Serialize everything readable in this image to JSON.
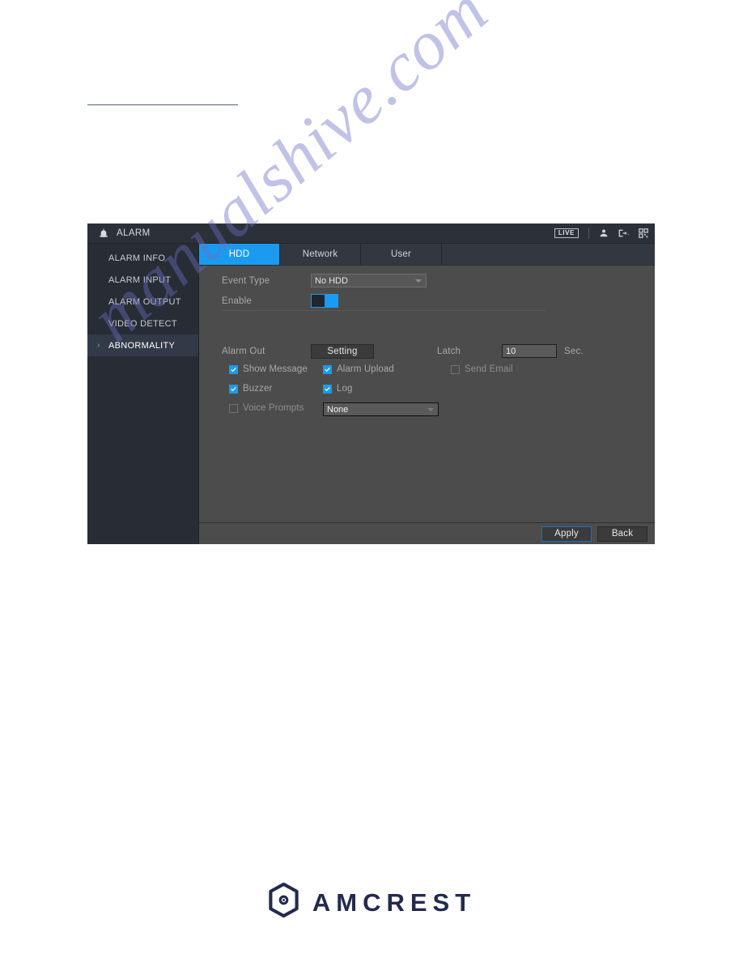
{
  "window": {
    "title": "ALARM",
    "title_icon": "alarm-siren-icon",
    "live_badge": "LIVE",
    "icons": [
      "user-icon",
      "logout-icon",
      "qr-code-icon"
    ]
  },
  "sidebar": {
    "items": [
      {
        "label": "ALARM INFO",
        "active": false
      },
      {
        "label": "ALARM INPUT",
        "active": false
      },
      {
        "label": "ALARM OUTPUT",
        "active": false
      },
      {
        "label": "VIDEO DETECT",
        "active": false
      },
      {
        "label": "ABNORMALITY",
        "active": true
      }
    ]
  },
  "tabs": [
    {
      "label": "HDD",
      "active": true
    },
    {
      "label": "Network",
      "active": false
    },
    {
      "label": "User",
      "active": false
    }
  ],
  "form": {
    "event_type_label": "Event Type",
    "event_type_value": "No HDD",
    "enable_label": "Enable",
    "enable_state": "on",
    "alarm_out_label": "Alarm Out",
    "setting_button": "Setting",
    "latch_label": "Latch",
    "latch_value": "10",
    "latch_unit": "Sec.",
    "checkboxes": [
      {
        "label": "Show Message",
        "checked": true
      },
      {
        "label": "Alarm Upload",
        "checked": true
      },
      {
        "label": "Send Email",
        "checked": false
      },
      {
        "label": "Buzzer",
        "checked": true
      },
      {
        "label": "Log",
        "checked": true
      },
      {
        "label": "Voice Prompts",
        "checked": false
      }
    ],
    "voice_prompts_label": "Voice Prompts",
    "voice_prompts_value": "None"
  },
  "footer": {
    "apply_label": "Apply",
    "back_label": "Back"
  },
  "brand": {
    "word": "AMCREST",
    "mark": "amcrest-hex-logo-icon"
  },
  "watermark": {
    "text": "manualshive.com",
    "color": "#6b6fc4"
  },
  "colors": {
    "accent": "#1a9bf0",
    "window_bg": "#4c4c4c",
    "sidebar_bg": "#282c34",
    "titlebar_bg": "#2c3038",
    "brand": "#222a4d"
  }
}
